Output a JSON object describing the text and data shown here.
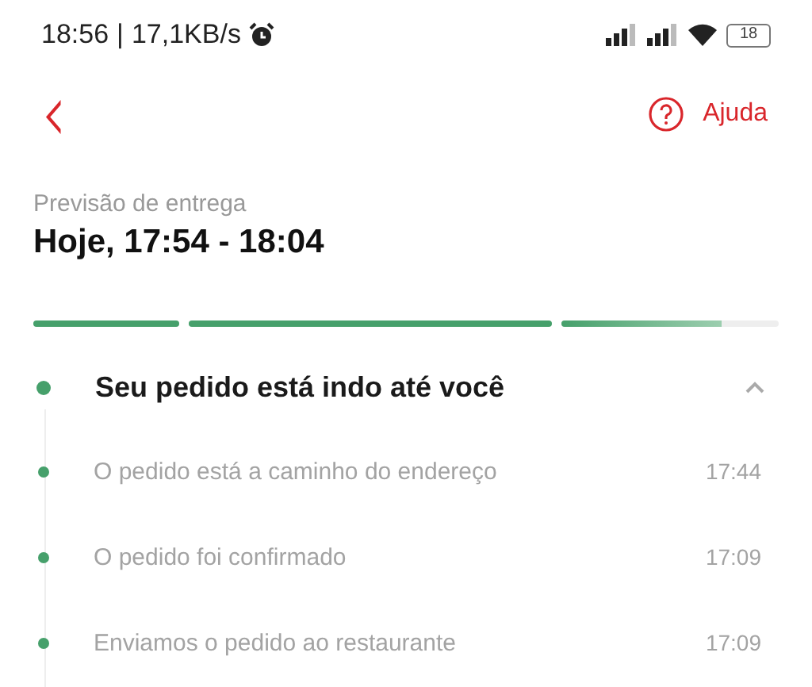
{
  "status_bar": {
    "time": "18:56",
    "separator": "|",
    "speed": "17,1KB/s",
    "battery": "18"
  },
  "header": {
    "back_icon": "‹",
    "help": "Ajuda"
  },
  "delivery": {
    "label": "Previsão de entrega",
    "time": "Hoje, 17:54 - 18:04"
  },
  "progress": [
    {
      "level": 1
    },
    {
      "level": 1
    },
    {
      "level": 0.74
    }
  ],
  "status": {
    "title": "Seu pedido está indo até você",
    "expanded": true,
    "steps": [
      {
        "text": "O pedido está a caminho do endereço",
        "time": "17:44"
      },
      {
        "text": "O pedido foi confirmado",
        "time": "17:09"
      },
      {
        "text": "Enviamos o pedido ao restaurante",
        "time": "17:09"
      }
    ]
  }
}
